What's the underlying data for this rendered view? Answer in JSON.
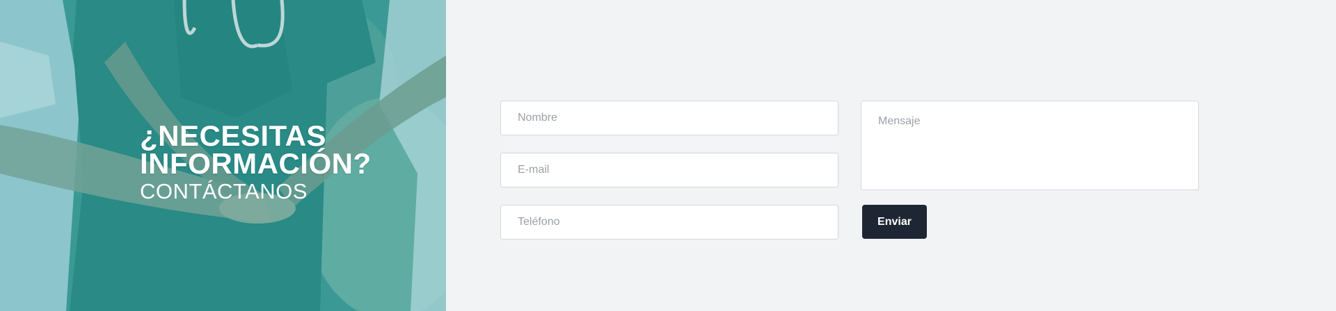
{
  "hero": {
    "title": "¿NECESITAS INFORMACIÓN?",
    "subtitle": "CONTÁCTANOS",
    "overlay_color": "#2b8a86"
  },
  "form": {
    "nombre_placeholder": "Nombre",
    "email_placeholder": "E-mail",
    "telefono_placeholder": "Teléfono",
    "mensaje_placeholder": "Mensaje",
    "submit_label": "Enviar",
    "button_color": "#1f2633"
  }
}
